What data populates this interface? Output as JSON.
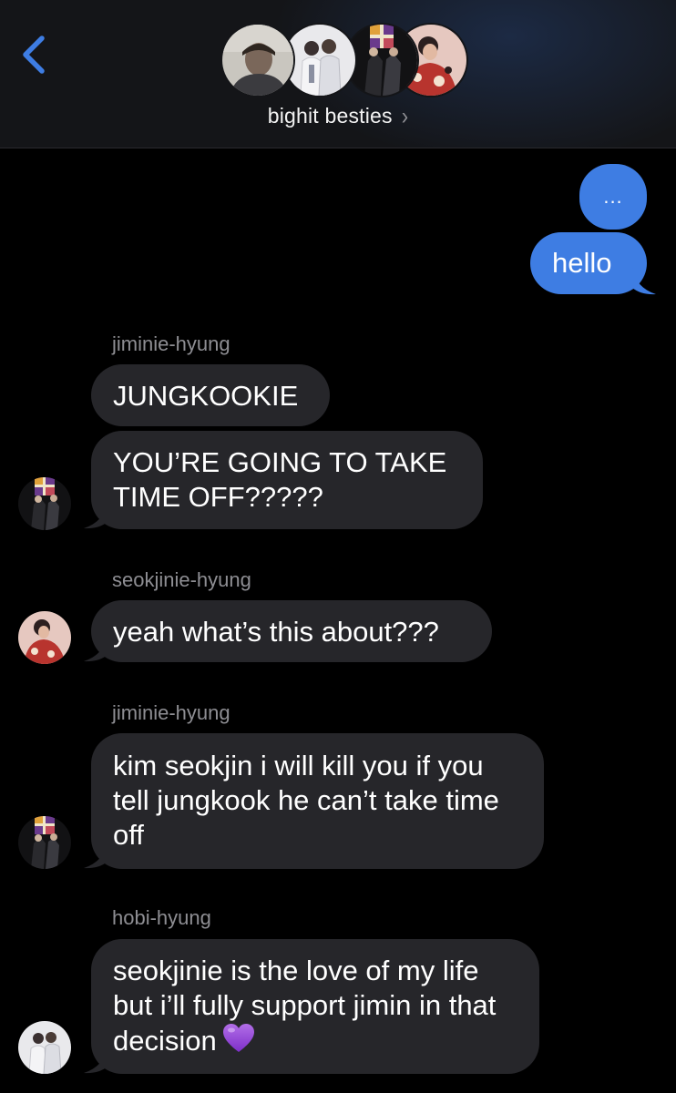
{
  "header": {
    "group_name": "bighit besties",
    "chevron": "›",
    "back_icon": "chevron-left-icon",
    "accent": "#3e7de3"
  },
  "thread": {
    "typing_indicator": "...",
    "outgoing": [
      {
        "text": "hello"
      }
    ],
    "groups": [
      {
        "sender": "jiminie-hyung",
        "messages": [
          "JUNGKOOKIE",
          "YOU’RE GOING TO TAKE TIME OFF?????"
        ]
      },
      {
        "sender": "seokjinie-hyung",
        "messages": [
          "yeah what’s this about???"
        ]
      },
      {
        "sender": "jiminie-hyung",
        "messages": [
          "kim seokjin i will kill you if you tell jungkook he can’t take time off"
        ]
      },
      {
        "sender": "hobi-hyung",
        "messages": [
          "seokjinie is the love of my life but i’ll fully support jimin in that decision"
        ],
        "emoji": "purple-heart"
      }
    ]
  },
  "colors": {
    "background": "#000000",
    "incoming_bubble": "#26262a",
    "outgoing_bubble": "#3e7de3",
    "sender_label": "#8e8e93"
  }
}
